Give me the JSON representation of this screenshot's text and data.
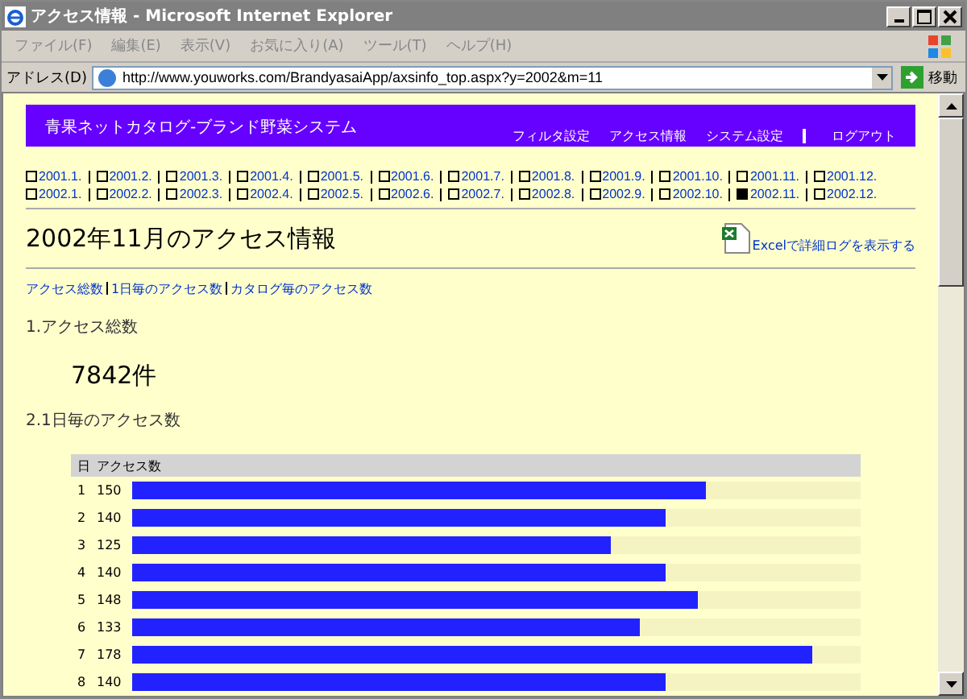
{
  "window": {
    "title": "アクセス情報 - Microsoft Internet Explorer"
  },
  "menu": [
    "ファイル(F)",
    "編集(E)",
    "表示(V)",
    "お気に入り(A)",
    "ツール(T)",
    "ヘルプ(H)"
  ],
  "address_bar": {
    "label": "アドレス(D)",
    "value": "http://www.youworks.com/BrandyasaiApp/axsinfo_top.aspx?y=2002&m=11",
    "go_button": "移動"
  },
  "header": {
    "title": "青果ネットカタログ-ブランド野菜システム",
    "nav": [
      "フィルタ設定",
      "アクセス情報",
      "システム設定",
      "ログアウト"
    ]
  },
  "months": [
    [
      {
        "label": "2001.1.",
        "selected": false
      },
      {
        "label": "2001.2.",
        "selected": false
      },
      {
        "label": "2001.3.",
        "selected": false
      },
      {
        "label": "2001.4.",
        "selected": false
      },
      {
        "label": "2001.5.",
        "selected": false
      },
      {
        "label": "2001.6.",
        "selected": false
      },
      {
        "label": "2001.7.",
        "selected": false
      },
      {
        "label": "2001.8.",
        "selected": false
      },
      {
        "label": "2001.9.",
        "selected": false
      },
      {
        "label": "2001.10.",
        "selected": false
      },
      {
        "label": "2001.11.",
        "selected": false
      },
      {
        "label": "2001.12.",
        "selected": false
      }
    ],
    [
      {
        "label": "2002.1.",
        "selected": false
      },
      {
        "label": "2002.2.",
        "selected": false
      },
      {
        "label": "2002.3.",
        "selected": false
      },
      {
        "label": "2002.4.",
        "selected": false
      },
      {
        "label": "2002.5.",
        "selected": false
      },
      {
        "label": "2002.6.",
        "selected": false
      },
      {
        "label": "2002.7.",
        "selected": false
      },
      {
        "label": "2002.8.",
        "selected": false
      },
      {
        "label": "2002.9.",
        "selected": false
      },
      {
        "label": "2002.10.",
        "selected": false
      },
      {
        "label": "2002.11.",
        "selected": true
      },
      {
        "label": "2002.12.",
        "selected": false
      }
    ]
  ],
  "page_title": "2002年11月のアクセス情報",
  "excel_link": "Excelで詳細ログを表示する",
  "section_links": [
    "アクセス総数",
    "1日毎のアクセス数",
    "カタログ毎のアクセス数"
  ],
  "total": {
    "heading": "1.アクセス総数",
    "value": "7842件"
  },
  "daily": {
    "heading": "2.1日毎のアクセス数",
    "columns": [
      "日",
      "アクセス数"
    ],
    "rows": [
      {
        "day": "1",
        "count": "150",
        "level": 0.787
      },
      {
        "day": "2",
        "count": "140",
        "level": 0.733
      },
      {
        "day": "3",
        "count": "125",
        "level": 0.656
      },
      {
        "day": "4",
        "count": "140",
        "level": 0.733
      },
      {
        "day": "5",
        "count": "148",
        "level": 0.776
      },
      {
        "day": "6",
        "count": "133",
        "level": 0.698
      },
      {
        "day": "7",
        "count": "178",
        "level": 0.933
      },
      {
        "day": "8",
        "count": "140",
        "level": 0.733
      }
    ]
  }
}
